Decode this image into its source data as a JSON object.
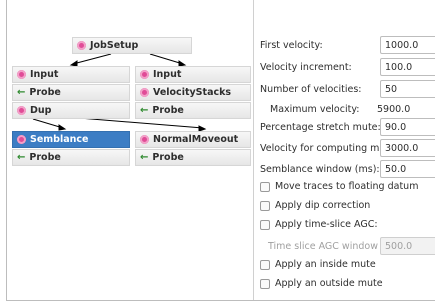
{
  "flow": {
    "job_setup": "JobSetup",
    "col_left": [
      "Input",
      "Probe",
      "Dup"
    ],
    "col_right": [
      "Input",
      "VelocityStacks",
      "Probe"
    ],
    "semblance": "Semblance",
    "nmo": "NormalMoveout",
    "probe_left": "Probe",
    "probe_right": "Probe"
  },
  "params": {
    "first_velocity": {
      "label": "First velocity:",
      "value": "1000.0"
    },
    "velocity_increment": {
      "label": "Velocity increment:",
      "value": "100.0"
    },
    "number_of_velocities": {
      "label": "Number of velocities:",
      "value": "50"
    },
    "maximum_velocity": {
      "label": "Maximum velocity:",
      "value": "5900.0"
    },
    "stretch_mute": {
      "label": "Percentage stretch mute:",
      "value": "90.0"
    },
    "velocity_mute": {
      "label": "Velocity for computing mute:",
      "value": "3000.0"
    },
    "semblance_window": {
      "label": "Semblance window (ms):",
      "value": "50.0"
    },
    "move_traces": "Move traces to floating datum",
    "dip_correction": "Apply dip correction",
    "time_slice_agc": "Apply time-slice AGC:",
    "agc_window": {
      "label": "Time slice AGC window (ms):",
      "value": "500.0"
    },
    "inside_mute": "Apply an inside mute",
    "outside_mute": "Apply an outside mute"
  }
}
